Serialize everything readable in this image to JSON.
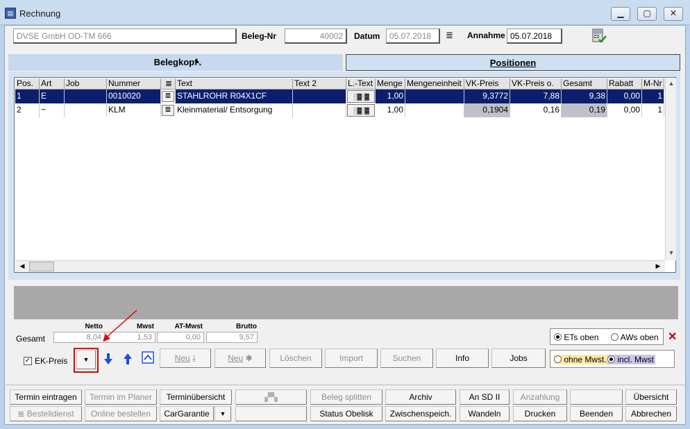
{
  "window": {
    "title": "Rechnung",
    "icon": "app-doc-icon"
  },
  "header": {
    "customer": "DVSE GmbH OD-TM 666",
    "beleg_nr_label": "Beleg-Nr",
    "beleg_nr": "40002",
    "datum_label": "Datum",
    "datum": "05.07.2018",
    "annahme_label": "Annahme",
    "annahme": "05.07.2018"
  },
  "tabs": {
    "belegkopf": "Belegkopf",
    "positionen": "Positionen"
  },
  "grid": {
    "columns": [
      "Pos.",
      "Art",
      "Job",
      "Nummer",
      "",
      "Text",
      "Text 2",
      "L.-Text",
      "Menge",
      "Mengeneinheit",
      "VK-Preis",
      "VK-Preis o.",
      "Gesamt",
      "Rabatt",
      "M-Nr"
    ],
    "rows": [
      {
        "pos": "1",
        "art": "E",
        "job": "",
        "nummer": "0010020",
        "text": "STAHLROHR R04X1CF",
        "text2": "",
        "menge": "1,00",
        "einheit": "",
        "vk": "9,3772",
        "vk_o": "7,88",
        "gesamt": "9,38",
        "rabatt": "0,00",
        "mnr": "1"
      },
      {
        "pos": "2",
        "art": "~",
        "job": "",
        "nummer": "KLM",
        "text": "Kleinmaterial/ Entsorgung",
        "text2": "",
        "menge": "1,00",
        "einheit": "",
        "vk": "0,1904",
        "vk_o": "0,16",
        "gesamt": "0,19",
        "rabatt": "0,00",
        "mnr": "1"
      }
    ]
  },
  "totals": {
    "row_label": "Gesamt",
    "netto_label": "Netto",
    "netto": "8,04",
    "mwst_label": "Mwst",
    "mwst": "1,53",
    "atmwst_label": "AT-Mwst",
    "atmwst": "0,00",
    "brutto_label": "Brutto",
    "brutto": "9,57"
  },
  "options": {
    "ets_oben": "ETs oben",
    "aws_oben": "AWs oben",
    "ohne_mwst": "ohne Mwst.",
    "incl_mwst": "incl. Mwst",
    "ek_preis": "EK-Preis"
  },
  "toolbar": {
    "neu1": "Neu",
    "neu2": "Neu",
    "loeschen": "Löschen",
    "import": "Import",
    "suchen": "Suchen",
    "info": "Info",
    "jobs": "Jobs"
  },
  "footer": {
    "termin_eintragen": "Termin eintragen",
    "termin_im_planer": "Termin im Planer",
    "terminuebersicht": "Terminübersicht",
    "beleg_splitten": "Beleg splitten",
    "archiv": "Archiv",
    "an_sd_ii": "An SD II",
    "anzahlung": "Anzahlung",
    "uebersicht": "Übersicht",
    "bestelldienst": "Bestelldienst",
    "online_bestellen": "Online bestellen",
    "cargarantie": "CarGarantie",
    "status_obelisk": "Status Obelisk",
    "zwischenspeich": "Zwischenspeich.",
    "wandeln": "Wandeln",
    "drucken": "Drucken",
    "beenden": "Beenden",
    "abbrechen": "Abbrechen"
  },
  "colors": {
    "selection": "#0b1f6e",
    "highlight_red": "#e00000",
    "tab_bg": "#cfe0f3"
  }
}
